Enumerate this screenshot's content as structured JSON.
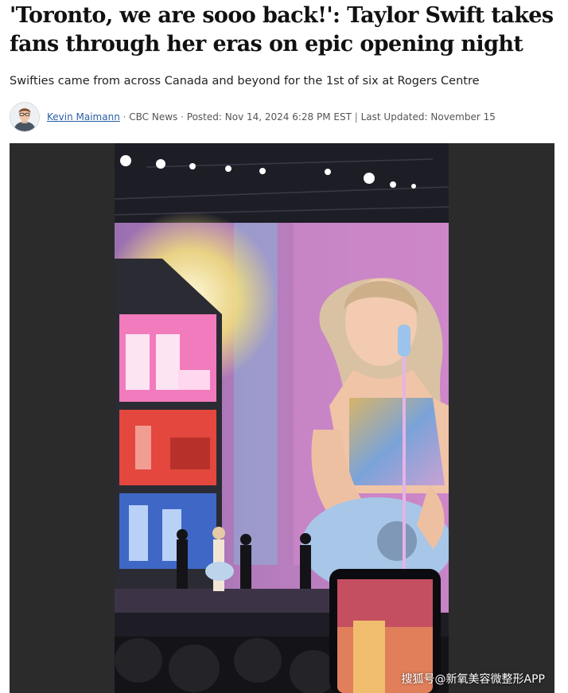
{
  "article": {
    "headline": "'Toronto, we are sooo back!': Taylor Swift takes fans through her eras on epic opening night",
    "deck": "Swifties came from across Canada and beyond for the 1st of six at Rogers Centre",
    "byline": {
      "author": "Kevin Maimann",
      "outlet": "CBC News",
      "posted": "Posted: Nov 14, 2024 6:28 PM EST",
      "updated": "Last Updated: November 15"
    }
  },
  "media": {
    "icon": "concert-video-frame",
    "watermark": "搜狐号@新氧美容微整形APP"
  }
}
